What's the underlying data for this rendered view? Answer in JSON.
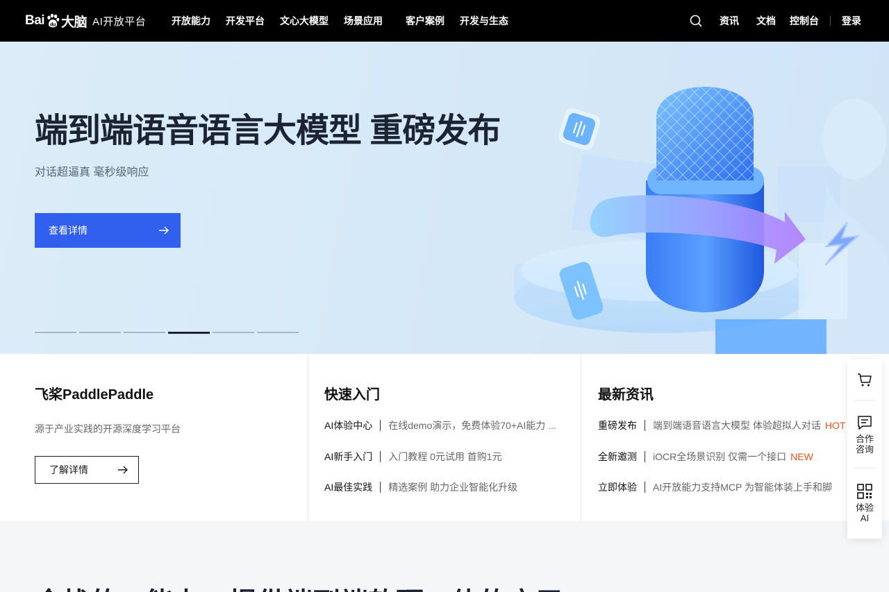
{
  "nav": {
    "logo_bai": "Bai",
    "logo_du": "大脑",
    "logo_title": "AI开放平台",
    "links": [
      "开放能力",
      "开发平台",
      "文心大模型",
      "场景应用",
      "客户案例",
      "开发与生态"
    ],
    "right": [
      "资讯",
      "文档",
      "控制台",
      "登录"
    ]
  },
  "hero": {
    "title": "端到端语音语言大模型 重磅发布",
    "subtitle": "对话超逼真 毫秒级响应",
    "button_label": "查看详情",
    "slide_count": 6,
    "active_slide": 4
  },
  "panel": {
    "paddle": {
      "title": "飞桨PaddlePaddle",
      "desc": "源于产业实践的开源深度学习平台",
      "button_label": "了解详情"
    },
    "quickstart": {
      "title": "快速入门",
      "rows": [
        {
          "key": "AI体验中心",
          "value": "在线demo演示，免费体验70+AI能力 ..."
        },
        {
          "key": "AI新手入门",
          "value": "入门教程 0元试用 首购1元"
        },
        {
          "key": "AI最佳实践",
          "value": "精选案例 助力企业智能化升级"
        }
      ]
    },
    "news": {
      "title": "最新资讯",
      "rows": [
        {
          "key": "重磅发布",
          "value": "端到端语音语言大模型 体验超拟人对话",
          "tag": "HOT"
        },
        {
          "key": "全新邀测",
          "value": "iOCR全场景识别 仅需一个接口",
          "tag": "NEW"
        },
        {
          "key": "立即体验",
          "value": "AI开放能力支持MCP 为智能体装上手和脚",
          "tag": ""
        }
      ]
    }
  },
  "float_bar": {
    "consult_line1": "合作",
    "consult_line2": "咨询",
    "try_line1": "体验",
    "try_line2": "AI"
  },
  "bottom": {
    "title": "全栈的AI能力，提供端到端软硬一体的应用"
  },
  "colors": {
    "primary": "#3160ef",
    "nav_bg": "#000000",
    "hero_bg": "#d6e9f8",
    "tag": "#e8531a"
  }
}
